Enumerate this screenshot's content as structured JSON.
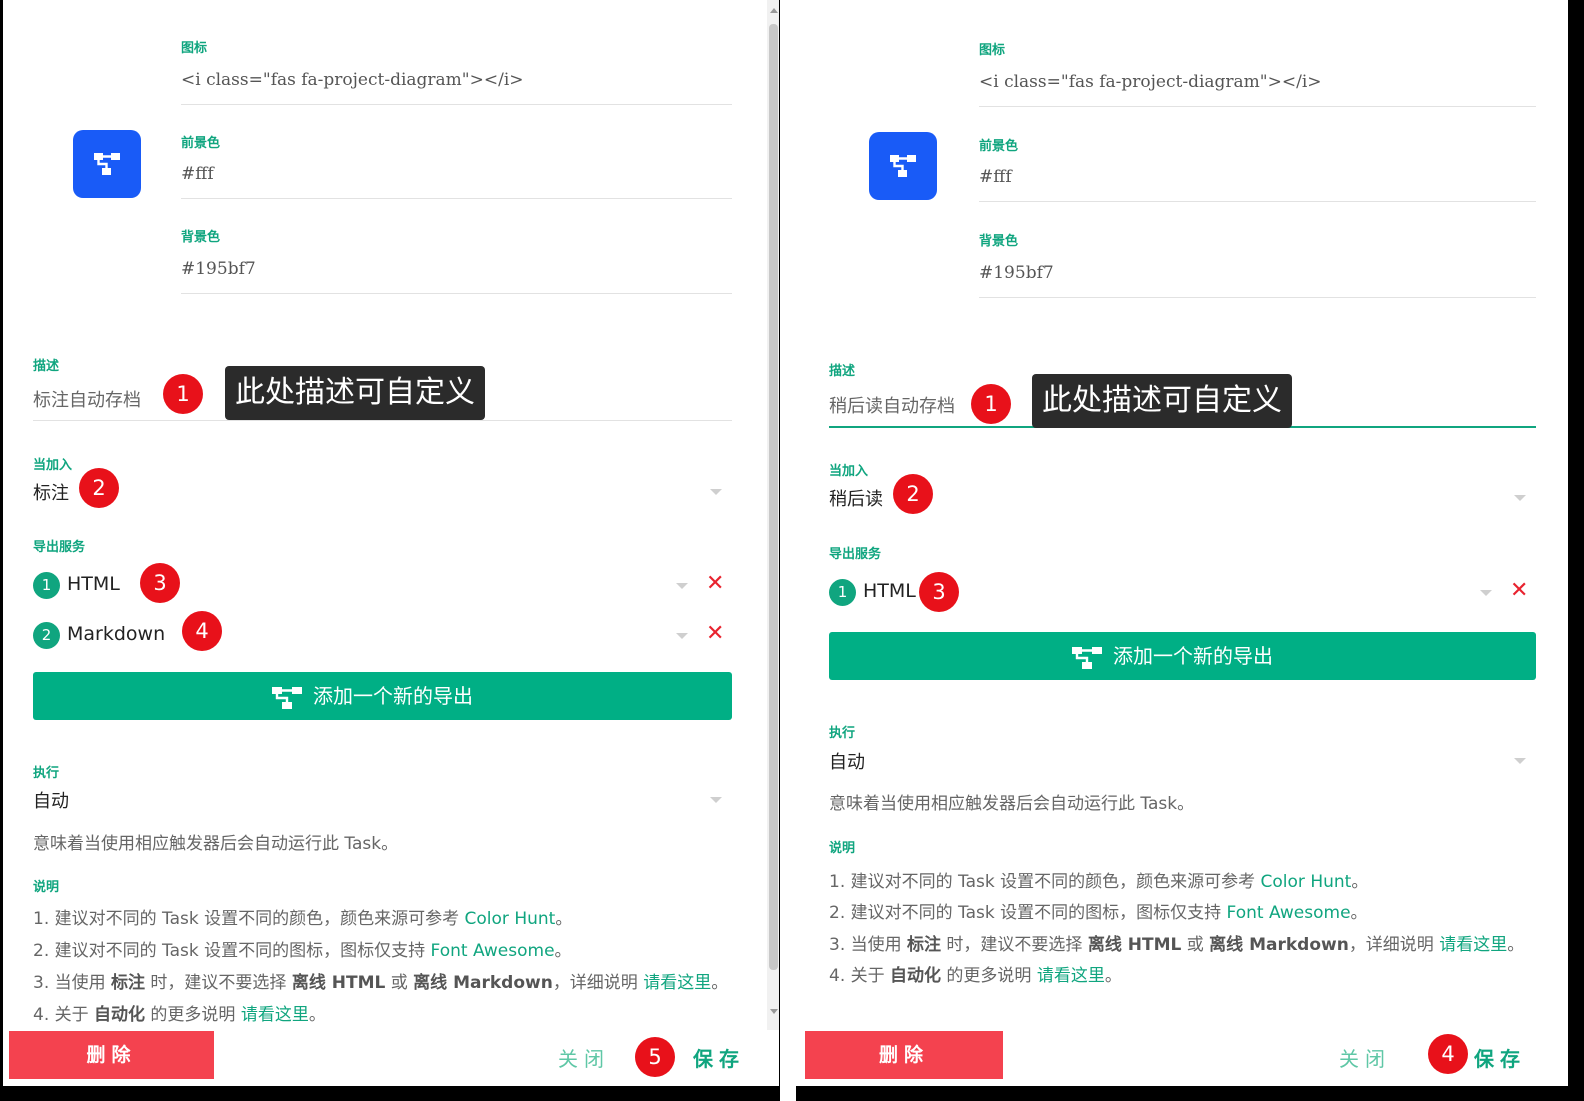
{
  "left": {
    "icon_label": "图标",
    "icon_value": "<i class=\"fas fa-project-diagram\"></i>",
    "fg_label": "前景色",
    "fg_value": "#fff",
    "bg_label": "背景色",
    "bg_value": "#195bf7",
    "desc_label": "描述",
    "desc_value": "标注自动存档",
    "tooltip": "此处描述可自定义",
    "when_label": "当加入",
    "when_value": "标注",
    "export_label": "导出服务",
    "services": [
      {
        "num": "1",
        "name": "HTML"
      },
      {
        "num": "2",
        "name": "Markdown"
      }
    ],
    "add_label": "添加一个新的导出",
    "exec_label": "执行",
    "exec_value": "自动",
    "exec_hint": "意味着当使用相应触发器后会自动运行此 Task。",
    "notes_label": "说明",
    "notes": {
      "n1_a": "1. 建议对不同的 Task 设置不同的颜色，颜色来源可参考 ",
      "n1_link": "Color Hunt",
      "n1_b": "。",
      "n2_a": "2. 建议对不同的 Task 设置不同的图标，图标仅支持 ",
      "n2_link": "Font Awesome",
      "n2_b": "。",
      "n3_a": "3. 当使用 ",
      "n3_b1": "标注",
      "n3_c": " 时，建议不要选择 ",
      "n3_b2": "离线 HTML",
      "n3_d": " 或 ",
      "n3_b3": "离线 Markdown",
      "n3_e": "，详细说明 ",
      "n3_link": "请看这里",
      "n3_f": "。",
      "n4_a": "4. 关于 ",
      "n4_b": "自动化",
      "n4_c": " 的更多说明 ",
      "n4_link": "请看这里",
      "n4_d": "。"
    },
    "delete_label": "删除",
    "close_label": "关闭",
    "save_label": "保存",
    "badges": [
      "1",
      "2",
      "3",
      "4",
      "5"
    ]
  },
  "right": {
    "icon_label": "图标",
    "icon_value": "<i class=\"fas fa-project-diagram\"></i>",
    "fg_label": "前景色",
    "fg_value": "#fff",
    "bg_label": "背景色",
    "bg_value": "#195bf7",
    "desc_label": "描述",
    "desc_value": "稍后读自动存档",
    "tooltip": "此处描述可自定义",
    "when_label": "当加入",
    "when_value": "稍后读",
    "export_label": "导出服务",
    "services": [
      {
        "num": "1",
        "name": "HTML"
      }
    ],
    "add_label": "添加一个新的导出",
    "exec_label": "执行",
    "exec_value": "自动",
    "exec_hint": "意味着当使用相应触发器后会自动运行此 Task。",
    "notes_label": "说明",
    "notes": {
      "n1_a": "1. 建议对不同的 Task 设置不同的颜色，颜色来源可参考 ",
      "n1_link": "Color Hunt",
      "n1_b": "。",
      "n2_a": "2. 建议对不同的 Task 设置不同的图标，图标仅支持 ",
      "n2_link": "Font Awesome",
      "n2_b": "。",
      "n3_a": "3. 当使用 ",
      "n3_b1": "标注",
      "n3_c": " 时，建议不要选择 ",
      "n3_b2": "离线 HTML",
      "n3_d": " 或 ",
      "n3_b3": "离线 Markdown",
      "n3_e": "，详细说明 ",
      "n3_link": "请看这里",
      "n3_f": "。",
      "n4_a": "4. 关于 ",
      "n4_b": "自动化",
      "n4_c": " 的更多说明 ",
      "n4_link": "请看这里",
      "n4_d": "。"
    },
    "delete_label": "删除",
    "close_label": "关闭",
    "save_label": "保存",
    "badges": [
      "1",
      "2",
      "3",
      "4"
    ]
  },
  "colors": {
    "accent": "#10a57f",
    "button_green": "#00af85",
    "delete_red": "#f4424f",
    "badge_red": "#e8111a",
    "icon_bg": "#195bf7",
    "icon_fg": "#ffffff"
  },
  "icons": {
    "task_icon": "project-diagram-icon",
    "add_icon": "project-diagram-icon",
    "remove_icon": "close-icon",
    "dropdown_icon": "caret-down-icon"
  }
}
